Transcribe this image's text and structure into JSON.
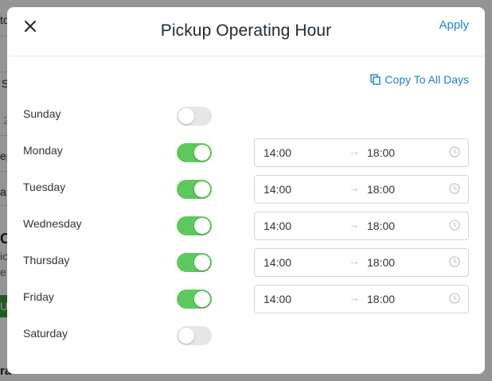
{
  "background": {
    "fragments": [
      "to",
      "S",
      "2",
      "ep",
      "a",
      "O",
      "ic",
      "e,",
      "U",
      "ra"
    ]
  },
  "modal": {
    "title": "Pickup Operating Hour",
    "apply_label": "Apply",
    "close_icon": "close-icon",
    "copy_label": "Copy To All Days",
    "copy_icon": "copy-icon",
    "accent": "#1e7fd0",
    "toggle_on_color": "#5cc95c",
    "days": [
      {
        "label": "Sunday",
        "enabled": false
      },
      {
        "label": "Monday",
        "enabled": true,
        "start": "14:00",
        "end": "18:00"
      },
      {
        "label": "Tuesday",
        "enabled": true,
        "start": "14:00",
        "end": "18:00"
      },
      {
        "label": "Wednesday",
        "enabled": true,
        "start": "14:00",
        "end": "18:00"
      },
      {
        "label": "Thursday",
        "enabled": true,
        "start": "14:00",
        "end": "18:00"
      },
      {
        "label": "Friday",
        "enabled": true,
        "start": "14:00",
        "end": "18:00"
      },
      {
        "label": "Saturday",
        "enabled": false
      }
    ],
    "arrow_glyph": "→",
    "clock_icon": "clock-icon"
  }
}
